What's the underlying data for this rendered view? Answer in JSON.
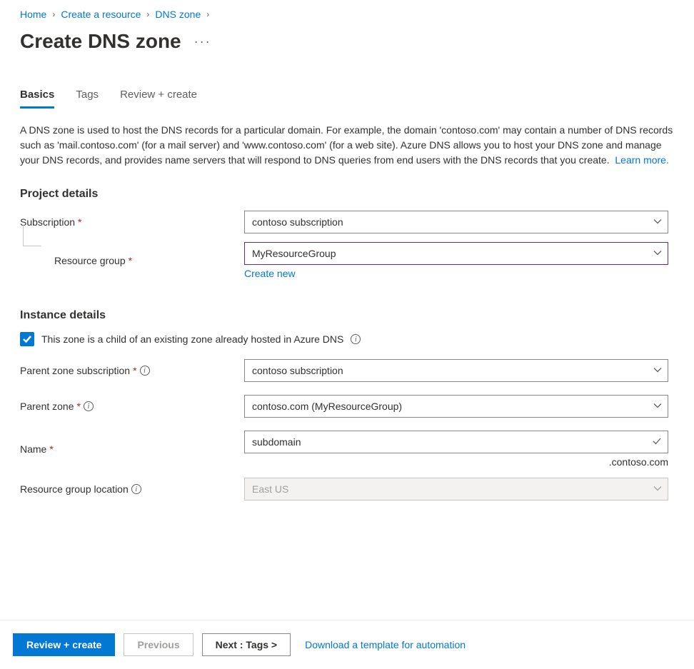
{
  "breadcrumb": {
    "items": [
      "Home",
      "Create a resource",
      "DNS zone"
    ]
  },
  "page": {
    "title": "Create DNS zone"
  },
  "tabs": {
    "items": [
      "Basics",
      "Tags",
      "Review + create"
    ]
  },
  "description": {
    "text": "A DNS zone is used to host the DNS records for a particular domain. For example, the domain 'contoso.com' may contain a number of DNS records such as 'mail.contoso.com' (for a mail server) and 'www.contoso.com' (for a web site). Azure DNS allows you to host your DNS zone and manage your DNS records, and provides name servers that will respond to DNS queries from end users with the DNS records that you create.",
    "learn_more": "Learn more."
  },
  "sections": {
    "project_details": "Project details",
    "instance_details": "Instance details"
  },
  "fields": {
    "subscription": {
      "label": "Subscription",
      "value": "contoso subscription"
    },
    "resource_group": {
      "label": "Resource group",
      "value": "MyResourceGroup",
      "create_new": "Create new"
    },
    "child_zone": {
      "label": "This zone is a child of an existing zone already hosted in Azure DNS"
    },
    "parent_zone_subscription": {
      "label": "Parent zone subscription",
      "value": "contoso subscription"
    },
    "parent_zone": {
      "label": "Parent zone",
      "value": "contoso.com (MyResourceGroup)"
    },
    "name": {
      "label": "Name",
      "value": "subdomain",
      "suffix": ".contoso.com"
    },
    "resource_group_location": {
      "label": "Resource group location",
      "value": "East US"
    }
  },
  "footer": {
    "review_create": "Review + create",
    "previous": "Previous",
    "next": "Next : Tags >",
    "download_template": "Download a template for automation"
  }
}
